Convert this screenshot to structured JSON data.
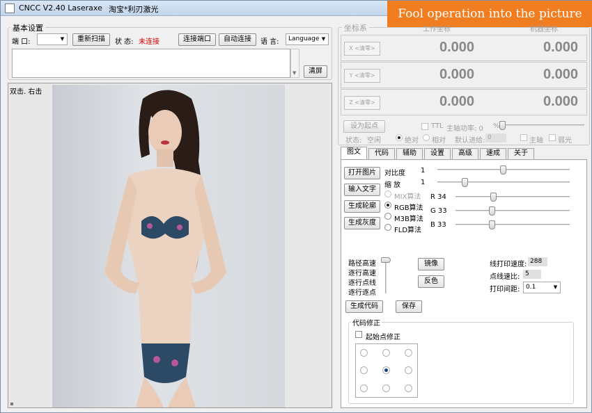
{
  "title": {
    "app": "CNCC V2.40  Laseraxe",
    "shop": "淘宝*利刃激光"
  },
  "banner": "Fool operation into the picture",
  "basic": {
    "group_label": "基本设置",
    "port_label": "端  口:",
    "port_value": "",
    "rescan": "重新扫描",
    "status_label": "状  态:",
    "status_value": "未连接",
    "connect": "连接端口",
    "auto_connect": "自动连接",
    "lang_label": "语  言:",
    "lang_value": "Language",
    "clear": "清屏"
  },
  "canvas_label": "双击. 右击",
  "coords": {
    "group_label": "坐标系",
    "col_work": "工作坐标",
    "col_machine": "机器坐标",
    "rows": [
      {
        "btn": "X <清零>",
        "work": "0.000",
        "machine": "0.000"
      },
      {
        "btn": "Y <清零>",
        "work": "0.000",
        "machine": "0.000"
      },
      {
        "btn": "Z <清零>",
        "work": "0.000",
        "machine": "0.000"
      }
    ],
    "set_origin": "设为起点",
    "ttl": "TTL",
    "spindle_power": "主轴功率: 0",
    "percent": "%",
    "state_label": "状态:",
    "state_value": "空闲",
    "absolute": "绝对",
    "relative": "相对",
    "default_feed": "默认进给:",
    "feed_value": "0",
    "spindle": "主轴",
    "weak_light": "弱光"
  },
  "tabs": [
    "图文",
    "代码",
    "辅助",
    "设置",
    "高级",
    "速成",
    "关于"
  ],
  "image_tab": {
    "open_image": "打开图片",
    "input_text": "输入文字",
    "gen_outline": "生成轮廓",
    "gen_gray": "生成灰度",
    "contrast_label": "对比度",
    "contrast_value": "1",
    "scale_label": "缩  放",
    "scale_value": "1",
    "algos": [
      "MIX算法",
      "RGB算法",
      "M3B算法",
      "FLD算法"
    ],
    "r_label": "R 34",
    "g_label": "G 33",
    "b_label": "B 33",
    "modes": [
      "路径高速",
      "逐行高速",
      "逐行点线",
      "逐行逐点"
    ],
    "mirror": "镜像",
    "invert": "反色",
    "line_speed_label": "线打印速度:",
    "line_speed_value": "288",
    "dot_ratio_label": "点线速比:",
    "dot_ratio_value": "5",
    "spacing_label": "打印间距:",
    "spacing_value": "0.1",
    "gen_code": "生成代码",
    "save": "保存",
    "fix_group": "代码修正",
    "start_fix": "起始点修正"
  }
}
